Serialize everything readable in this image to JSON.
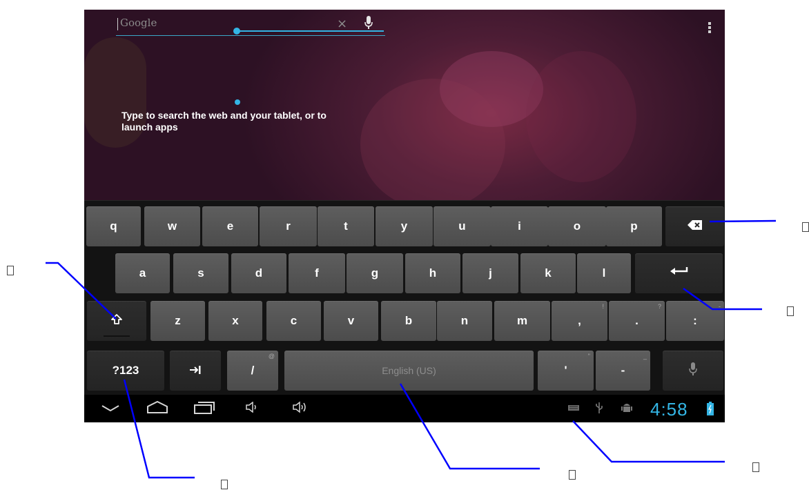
{
  "search": {
    "placeholder": "Google",
    "hint": "Type to search the web and your tablet, or to launch apps"
  },
  "keyboard": {
    "rows": [
      [
        {
          "label": "q",
          "name": "key-q"
        },
        {
          "label": "w",
          "name": "key-w"
        },
        {
          "label": "e",
          "name": "key-e"
        },
        {
          "label": "r",
          "name": "key-r"
        },
        {
          "label": "t",
          "name": "key-t"
        },
        {
          "label": "y",
          "name": "key-y"
        },
        {
          "label": "u",
          "name": "key-u"
        },
        {
          "label": "i",
          "name": "key-i"
        },
        {
          "label": "o",
          "name": "key-o"
        },
        {
          "label": "p",
          "name": "key-p"
        },
        {
          "label": "",
          "icon": "backspace-icon",
          "name": "key-backspace",
          "dark": true
        }
      ],
      [
        {
          "label": "a",
          "name": "key-a"
        },
        {
          "label": "s",
          "name": "key-s"
        },
        {
          "label": "d",
          "name": "key-d"
        },
        {
          "label": "f",
          "name": "key-f"
        },
        {
          "label": "g",
          "name": "key-g"
        },
        {
          "label": "h",
          "name": "key-h"
        },
        {
          "label": "j",
          "name": "key-j"
        },
        {
          "label": "k",
          "name": "key-k"
        },
        {
          "label": "l",
          "name": "key-l"
        },
        {
          "label": "",
          "icon": "enter-icon",
          "name": "key-enter",
          "dark": true
        }
      ],
      [
        {
          "label": "",
          "icon": "shift-icon",
          "name": "key-shift",
          "dark": true
        },
        {
          "label": "z",
          "name": "key-z"
        },
        {
          "label": "x",
          "name": "key-x"
        },
        {
          "label": "c",
          "name": "key-c"
        },
        {
          "label": "v",
          "name": "key-v"
        },
        {
          "label": "b",
          "name": "key-b"
        },
        {
          "label": "n",
          "name": "key-n"
        },
        {
          "label": "m",
          "name": "key-m"
        },
        {
          "label": ",",
          "sub": "!",
          "name": "key-comma"
        },
        {
          "label": ".",
          "sub": "?",
          "name": "key-period"
        },
        {
          "label": ":",
          "sub": "-",
          "name": "key-colon"
        }
      ],
      [
        {
          "label": "?123",
          "name": "key-symbols",
          "dark": true
        },
        {
          "label": "",
          "icon": "tab-icon",
          "name": "key-tab",
          "dark": true
        },
        {
          "label": "/",
          "sub": "@",
          "name": "key-slash"
        },
        {
          "label": "English (US)",
          "name": "key-space",
          "space": true
        },
        {
          "label": "'",
          "sub": "\"",
          "name": "key-apostrophe"
        },
        {
          "label": "-",
          "sub": "_",
          "name": "key-hyphen"
        },
        {
          "label": "",
          "icon": "microphone-icon",
          "name": "key-voice",
          "dark": true
        }
      ]
    ]
  },
  "navbar": {
    "buttons": [
      {
        "name": "hide-keyboard-button",
        "icon": "chevron-down-icon"
      },
      {
        "name": "home-button",
        "icon": "home-icon"
      },
      {
        "name": "recent-apps-button",
        "icon": "recent-apps-icon"
      },
      {
        "name": "volume-down-button",
        "icon": "volume-down-icon"
      },
      {
        "name": "volume-up-button",
        "icon": "volume-up-icon"
      }
    ],
    "status_icons": [
      "keyboard-icon",
      "usb-icon",
      "android-debug-icon",
      "battery-icon"
    ],
    "time": "4:58"
  },
  "colors": {
    "accent": "#33b5e5",
    "callout_line": "#0000ff",
    "key": "#555555",
    "key_dark": "#282828"
  }
}
